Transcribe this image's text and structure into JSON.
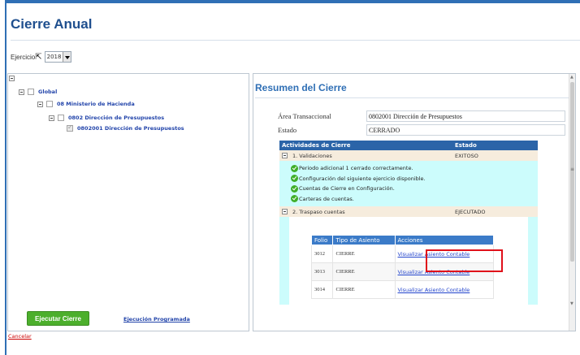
{
  "page": {
    "title": "Cierre Anual"
  },
  "ejercicio": {
    "label": "Ejercicio",
    "value": "2018"
  },
  "tree": {
    "nodes": [
      {
        "label": "Global"
      },
      {
        "label": "08 Ministerio de Hacienda"
      },
      {
        "label": "0802 Dirección de Presupuestos"
      },
      {
        "label": "0802001 Dirección de Presupuestos"
      }
    ]
  },
  "actions": {
    "execute_label": "Ejecutar Cierre",
    "scheduled_label": "Ejecución Programada",
    "cancel_label": "Cancelar"
  },
  "resumen": {
    "title": "Resumen del Cierre",
    "area_label": "Área Transaccional",
    "area_value": "0802001 Dirección de Presupuestos",
    "estado_label": "Estado",
    "estado_value": "CERRADO"
  },
  "activities": {
    "header": {
      "col1": "Actividades de Cierre",
      "col2": "Estado"
    },
    "groups": [
      {
        "label": "1. Validaciones",
        "state": "EXITOSO",
        "messages": [
          "Periodo adicional 1 cerrado correctamente.",
          "Configuración del siguiente ejercicio disponible.",
          "Cuentas de Cierre en Configuración.",
          "Carteras de cuentas."
        ]
      },
      {
        "label": "2. Traspaso cuentas",
        "state": "EJECUTADO"
      }
    ]
  },
  "asientos": {
    "headers": [
      "Folio",
      "Tipo de Asiento",
      "Acciones"
    ],
    "rows": [
      {
        "folio": "3012",
        "tipo": "CIERRE",
        "accion": "Visualizar Asiento Contable"
      },
      {
        "folio": "3013",
        "tipo": "CIERRE",
        "accion": "Visualizar Asiento Contable"
      },
      {
        "folio": "3014",
        "tipo": "CIERRE",
        "accion": "Visualizar Asiento Contable"
      }
    ]
  },
  "colors": {
    "primary": "#2f6fb5",
    "execute_button": "#4caf2c",
    "detail_background": "#ccfcfc",
    "highlight": "#e0101a"
  }
}
